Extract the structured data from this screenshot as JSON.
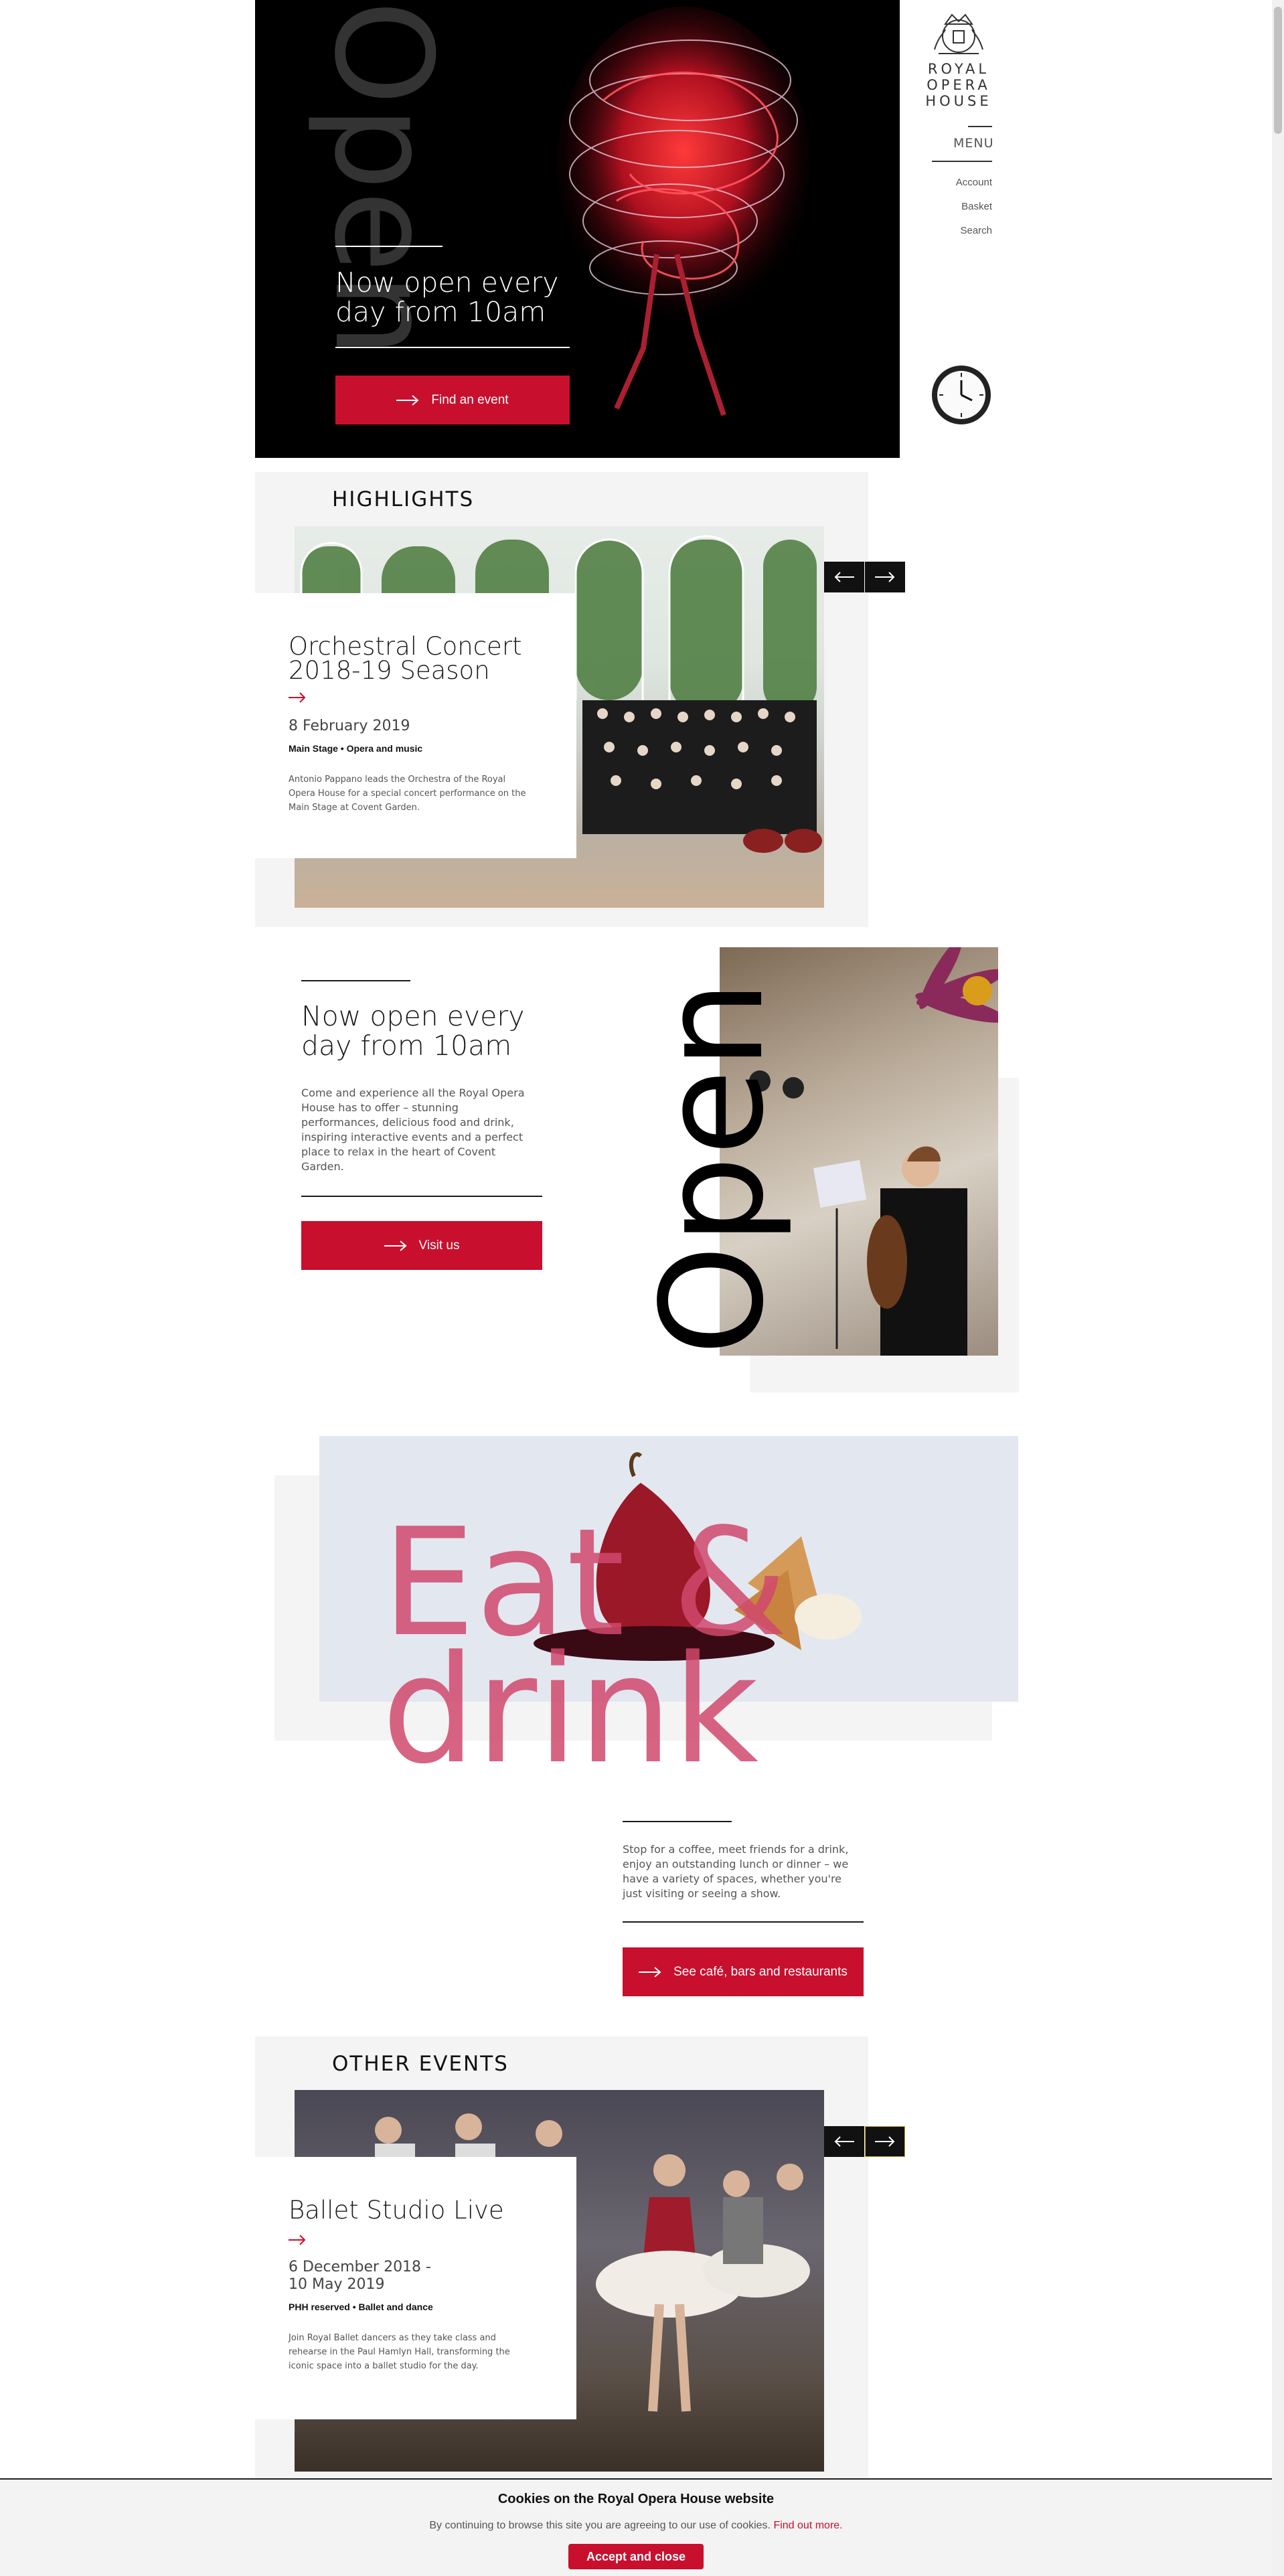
{
  "brand": {
    "line1": "ROYAL",
    "line2": "OPERA",
    "line3": "HOUSE",
    "accent": "#c8102e"
  },
  "nav": {
    "menu": "MENU",
    "account": "Account",
    "basket": "Basket",
    "search": "Search"
  },
  "hero": {
    "vertical_word": "Open",
    "headline_1": "Now open every",
    "headline_2": "day from 10am",
    "button": "Find an event"
  },
  "highlights": {
    "title": "HIGHLIGHTS",
    "card": {
      "title_1": "Orchestral Concert",
      "title_2": "2018-19 Season",
      "date": "8 February 2019",
      "tags": "Main Stage • Opera and music",
      "desc_1": "Antonio Pappano leads the Orchestra of the Royal",
      "desc_2": "Opera House for a special concert performance on the",
      "desc_3": "Main Stage at Covent Garden."
    }
  },
  "open_section": {
    "headline_1": "Now open every",
    "headline_2": "day from 10am",
    "body_1": "Come and experience all the Royal Opera",
    "body_2": "House has to offer – stunning",
    "body_3": "performances, delicious food and drink,",
    "body_4": "inspiring interactive events and a perfect",
    "body_5": "place to relax in the heart of Covent",
    "body_6": "Garden.",
    "button": "Visit us",
    "vertical_word": "Open"
  },
  "eat": {
    "word_1": "Eat &",
    "word_2": "drink",
    "body_1": "Stop for a coffee, meet friends for a drink,",
    "body_2": "enjoy an outstanding lunch or dinner – we",
    "body_3": "have a variety of spaces, whether you're",
    "body_4": "just visiting or seeing a show.",
    "button": "See café, bars and restaurants"
  },
  "other_events": {
    "title": "OTHER EVENTS",
    "card": {
      "title": "Ballet Studio Live",
      "date_1": "6 December 2018 -",
      "date_2": "10 May 2019",
      "tags": "PHH reserved • Ballet and dance",
      "desc_1": "Join Royal Ballet dancers as they take class and",
      "desc_2": "rehearse in the Paul Hamlyn Hall, transforming the",
      "desc_3": "iconic space into a ballet studio for the day."
    }
  },
  "cookies": {
    "title": "Cookies on the Royal Opera House website",
    "text": "By continuing to browse this site you are agreeing to our use of cookies.",
    "link": "Find out more.",
    "button": "Accept and close"
  }
}
